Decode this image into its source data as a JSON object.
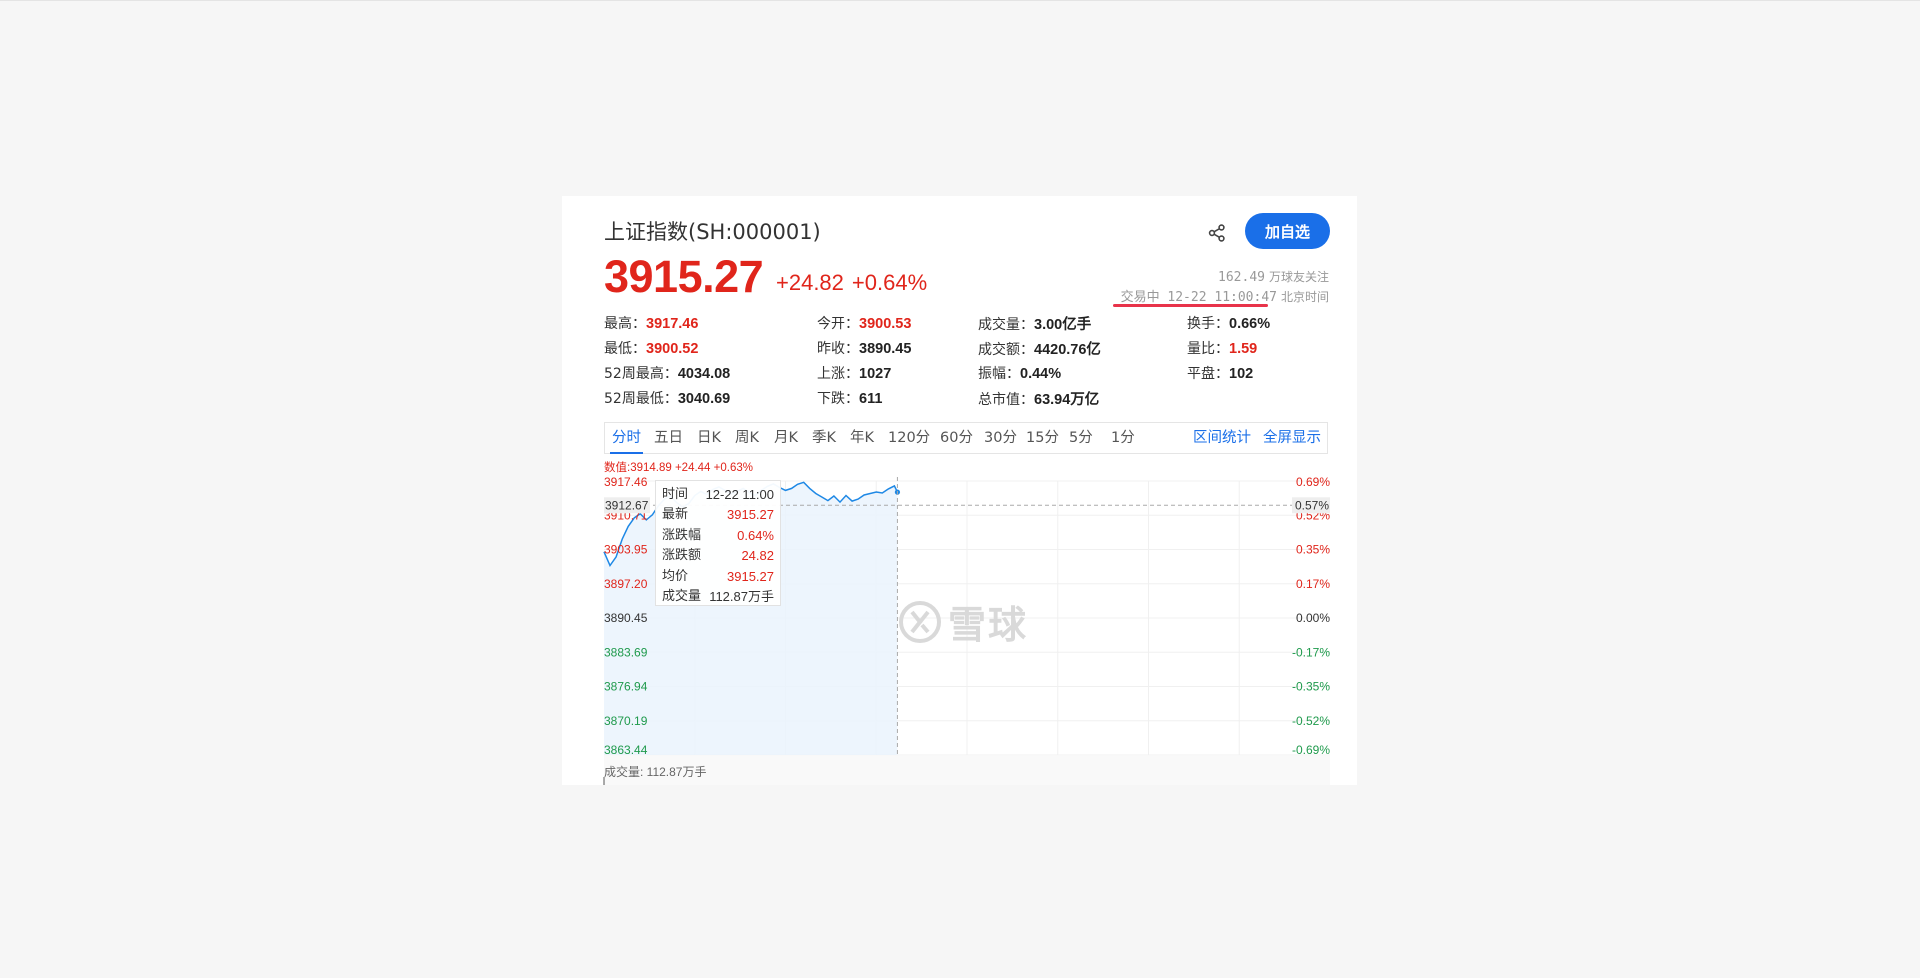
{
  "header": {
    "title": "上证指数(SH:000001)",
    "follow_button": "加自选",
    "price": "3915.27",
    "change": "+24.82",
    "change_pct": "+0.64%",
    "followers_count": "162.49",
    "followers_label": "万球友关注",
    "trading_status": "交易中 12-22 11:00:47",
    "timezone": "北京时间"
  },
  "stats": [
    {
      "label": "最高",
      "value": "3917.46",
      "color": "red"
    },
    {
      "label": "今开",
      "value": "3900.53",
      "color": "red"
    },
    {
      "label": "成交量",
      "value": "3.00亿手",
      "color": "dark"
    },
    {
      "label": "换手",
      "value": "0.66%",
      "color": "dark"
    },
    {
      "label": "最低",
      "value": "3900.52",
      "color": "red"
    },
    {
      "label": "昨收",
      "value": "3890.45",
      "color": "dark"
    },
    {
      "label": "成交额",
      "value": "4420.76亿",
      "color": "dark"
    },
    {
      "label": "量比",
      "value": "1.59",
      "color": "red"
    },
    {
      "label": "52周最高",
      "value": "4034.08",
      "color": "dark"
    },
    {
      "label": "上涨",
      "value": "1027",
      "color": "dark"
    },
    {
      "label": "振幅",
      "value": "0.44%",
      "color": "dark"
    },
    {
      "label": "平盘",
      "value": "102",
      "color": "dark"
    },
    {
      "label": "52周最低",
      "value": "3040.69",
      "color": "dark"
    },
    {
      "label": "下跌",
      "value": "611",
      "color": "dark"
    },
    {
      "label": "总市值",
      "value": "63.94万亿",
      "color": "dark"
    }
  ],
  "tabs": [
    "分时",
    "五日",
    "日K",
    "周K",
    "月K",
    "季K",
    "年K",
    "120分",
    "60分",
    "30分",
    "15分",
    "5分",
    "1分"
  ],
  "active_tab": "分时",
  "tab_actions": [
    "区间统计",
    "全屏显示"
  ],
  "chart_info": "数值:3914.89 +24.44 +0.63%",
  "volume_label": "成交量: 112.87万手",
  "tooltip": [
    {
      "label": "时间",
      "value": "12-22 11:00",
      "color": "dark"
    },
    {
      "label": "最新",
      "value": "3915.27",
      "color": "red"
    },
    {
      "label": "涨跌幅",
      "value": "0.64%",
      "color": "red"
    },
    {
      "label": "涨跌额",
      "value": "24.82",
      "color": "red"
    },
    {
      "label": "均价",
      "value": "3915.27",
      "color": "red"
    },
    {
      "label": "成交量",
      "value": "112.87万手",
      "color": "dark"
    }
  ],
  "watermark": "雪球",
  "colors": {
    "up": "#e0251b",
    "down": "#1f9a4c",
    "accent": "#1a6fe8",
    "line": "#1e88e5"
  },
  "icons": {
    "share": "share-icon",
    "watermark": "snowball-logo-icon"
  },
  "chart_data": {
    "type": "line",
    "title": "",
    "xlabel": "",
    "ylabel": "",
    "ylim": [
      3863.44,
      3917.46
    ],
    "y_ticks_left": [
      "3917.46",
      "3910.71",
      "3903.95",
      "3897.20",
      "3890.45",
      "3883.69",
      "3876.94",
      "3870.19",
      "3863.44"
    ],
    "y_ticks_right": [
      "0.69%",
      "0.52%",
      "0.35%",
      "0.17%",
      "0.00%",
      "-0.17%",
      "-0.35%",
      "-0.52%",
      "-0.69%"
    ],
    "crosshair_value": "3912.67",
    "crosshair_pct": "0.57%",
    "prev_close": 3890.45,
    "time_slots_total": 241,
    "series": [
      {
        "x": [
          0,
          2,
          4,
          6,
          8,
          10,
          12,
          14,
          16,
          18,
          20,
          22,
          24,
          26,
          28,
          30,
          32,
          34,
          36,
          38,
          40,
          42,
          44,
          46,
          48,
          50,
          52,
          54,
          56,
          58,
          60,
          62,
          64,
          66,
          68,
          70,
          72,
          74,
          76,
          78,
          80,
          82,
          84,
          86,
          88,
          90,
          92,
          94,
          96,
          97
        ],
        "values": [
          3903.5,
          3900.8,
          3902.5,
          3906.0,
          3908.5,
          3910.2,
          3911.0,
          3909.8,
          3910.8,
          3912.6,
          3913.9,
          3914.5,
          3913.2,
          3912.4,
          3913.0,
          3914.6,
          3915.4,
          3914.8,
          3915.8,
          3916.3,
          3915.6,
          3914.9,
          3915.4,
          3916.0,
          3915.2,
          3914.6,
          3915.6,
          3916.4,
          3916.9,
          3916.2,
          3915.6,
          3916.0,
          3916.8,
          3917.2,
          3916.0,
          3915.0,
          3914.3,
          3913.6,
          3914.5,
          3913.3,
          3914.6,
          3913.5,
          3913.9,
          3914.7,
          3915.0,
          3915.3,
          3915.1,
          3915.9,
          3916.5,
          3915.27
        ]
      }
    ]
  }
}
